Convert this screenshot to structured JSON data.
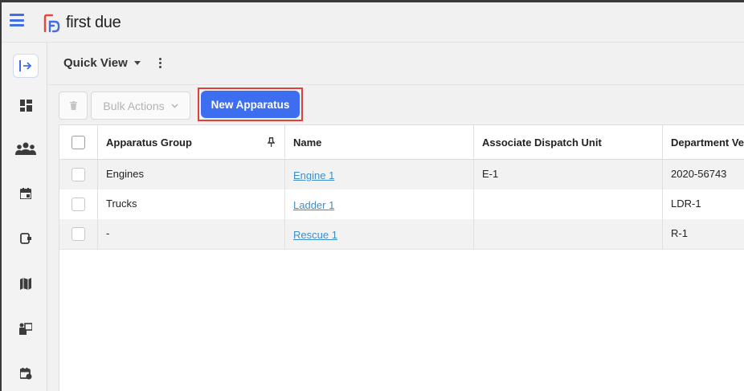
{
  "app": {
    "brand": "first due"
  },
  "colors": {
    "accent": "#3d6ef0",
    "highlight": "#e0403a",
    "link": "#3f8ec8"
  },
  "rail": {
    "items": [
      {
        "icon": "expand-sidebar-icon"
      },
      {
        "icon": "dashboard-icon"
      },
      {
        "icon": "people-icon"
      },
      {
        "icon": "calendar-icon"
      },
      {
        "icon": "device-icon"
      },
      {
        "icon": "map-icon"
      },
      {
        "icon": "training-icon"
      },
      {
        "icon": "schedule-icon"
      }
    ]
  },
  "viewbar": {
    "title": "Quick View"
  },
  "toolbar": {
    "bulk_label": "Bulk Actions",
    "new_label": "New Apparatus"
  },
  "table": {
    "columns": [
      "Apparatus Group",
      "Name",
      "Associate Dispatch Unit",
      "Department Veh"
    ],
    "rows": [
      {
        "group": "Engines",
        "name": "Engine 1",
        "unit": "E-1",
        "vehicle": "2020-56743"
      },
      {
        "group": "Trucks",
        "name": "Ladder 1",
        "unit": "",
        "vehicle": "LDR-1"
      },
      {
        "group": "-",
        "name": "Rescue 1",
        "unit": "",
        "vehicle": "R-1"
      }
    ]
  }
}
